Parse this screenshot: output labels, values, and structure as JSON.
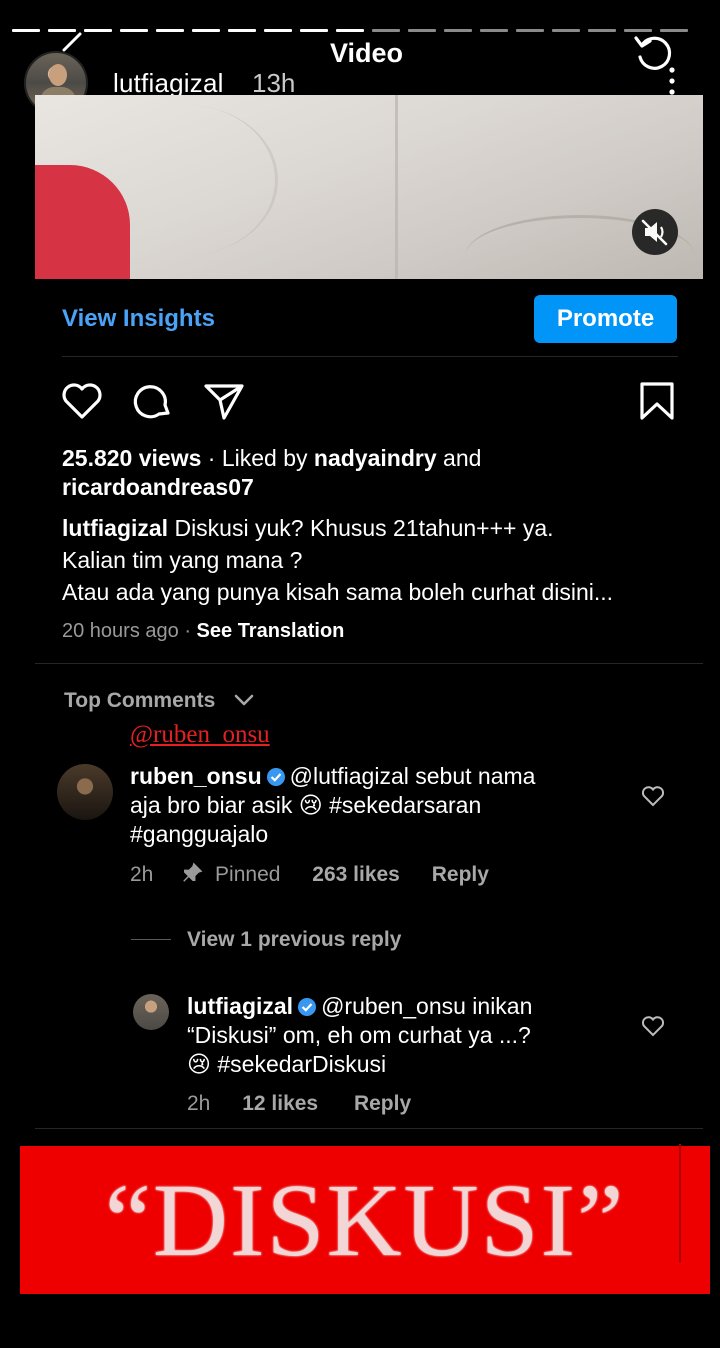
{
  "header": {
    "title": "Video",
    "username": "lutfiagizal",
    "time": "13h"
  },
  "actions": {
    "view_insights": "View Insights",
    "promote": "Promote"
  },
  "post": {
    "views": "25.820 views",
    "liked_by_prefix": "Liked by",
    "liked_user_1": "nadyaindry",
    "liked_and": "and",
    "liked_user_2": "ricardoandreas07",
    "caption_user": "lutfiagizal",
    "caption_line1": "Diskusi yuk? Khusus 21tahun+++ ya.",
    "caption_line2": "Kalian tim yang mana ?",
    "caption_line3": "Atau ada yang punya kisah sama boleh curhat disini...",
    "time_ago": "20 hours ago",
    "see_translation": "See Translation"
  },
  "comments_header": {
    "label": "Top Comments",
    "overlay_mention": "@ruben_onsu"
  },
  "comment1": {
    "user": "ruben_onsu",
    "line1": "@lutfiagizal sebut nama",
    "line2": "aja bro biar asik 😢 #sekedarsaran",
    "line3": "#gangguajalo",
    "time": "2h",
    "pinned": "Pinned",
    "likes": "263 likes",
    "reply": "Reply",
    "view_previous": "View 1 previous reply"
  },
  "comment2": {
    "user": "lutfiagizal",
    "line1": "@ruben_onsu inikan",
    "line2": "“Diskusi” om, eh om curhat ya ...?",
    "line3": "😢 #sekedarDiskusi",
    "time": "2h",
    "likes": "12 likes",
    "reply": "Reply"
  },
  "banner": {
    "text": "“DISKUSI”"
  },
  "colors": {
    "accent_blue": "#0095f6",
    "link_blue": "#4aa3f7",
    "banner_red": "#ee0000",
    "verified_blue": "#3897f0"
  },
  "icons": [
    "back-icon",
    "refresh-icon",
    "more-icon",
    "mute-icon",
    "heart-icon",
    "comment-icon",
    "share-icon",
    "save-icon",
    "chevron-down-icon",
    "verified-icon",
    "pin-icon"
  ]
}
